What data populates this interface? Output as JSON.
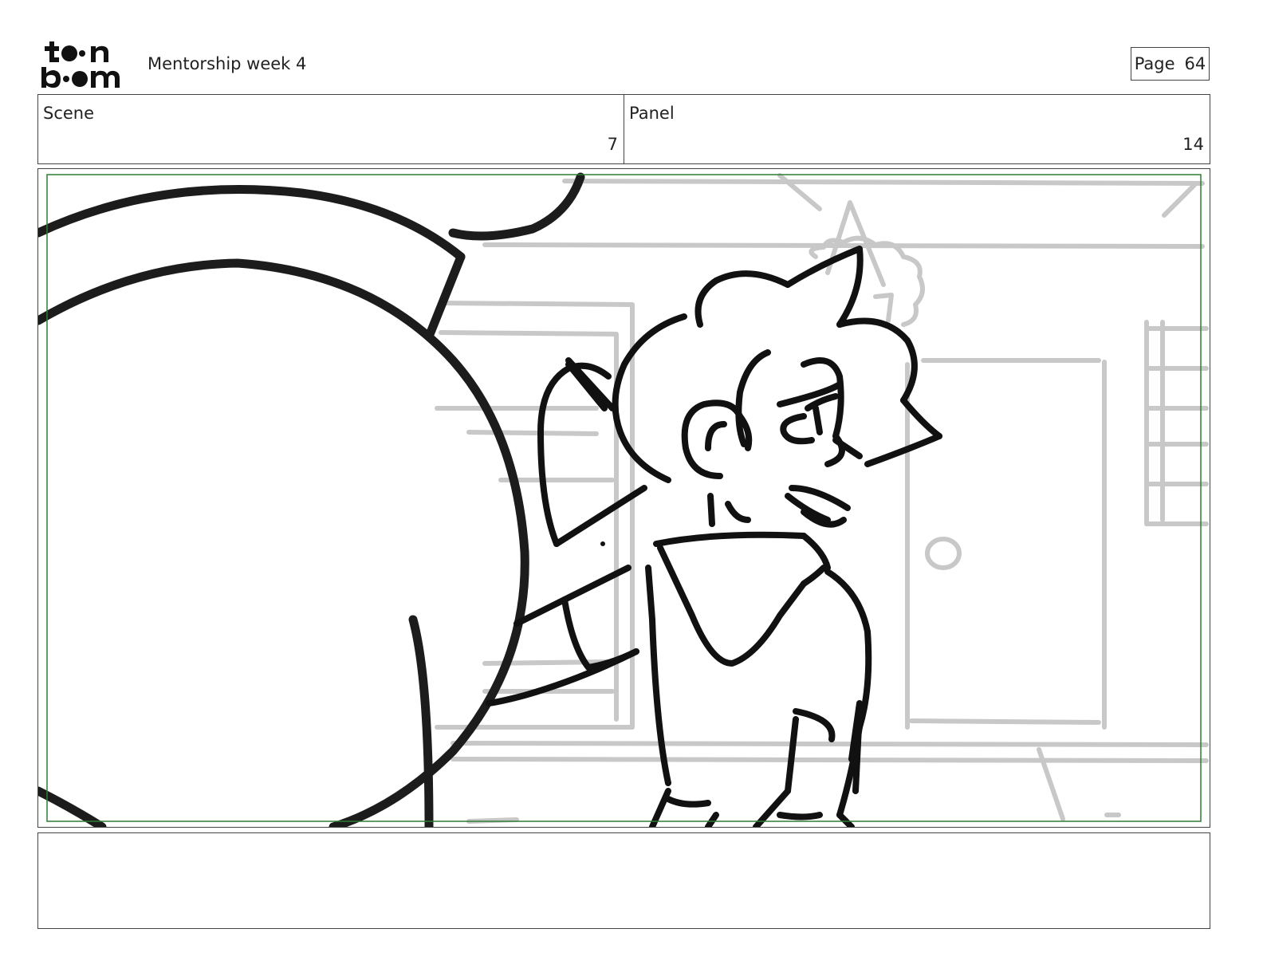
{
  "header": {
    "logo": {
      "icon": "toon-boom-logo",
      "text": "toon boom"
    },
    "title": "Mentorship week 4",
    "page_label": "Page",
    "page_number": "64"
  },
  "scene": {
    "label": "Scene",
    "value": "7"
  },
  "panel": {
    "label": "Panel",
    "value": "14"
  },
  "artwork": {
    "icon": "storyboard-sketch",
    "safe_area_color": "#2e7d32",
    "line_color": "#1a1a1a",
    "background_sketch_color": "#c8c8c8"
  },
  "notes": {
    "text": ""
  }
}
